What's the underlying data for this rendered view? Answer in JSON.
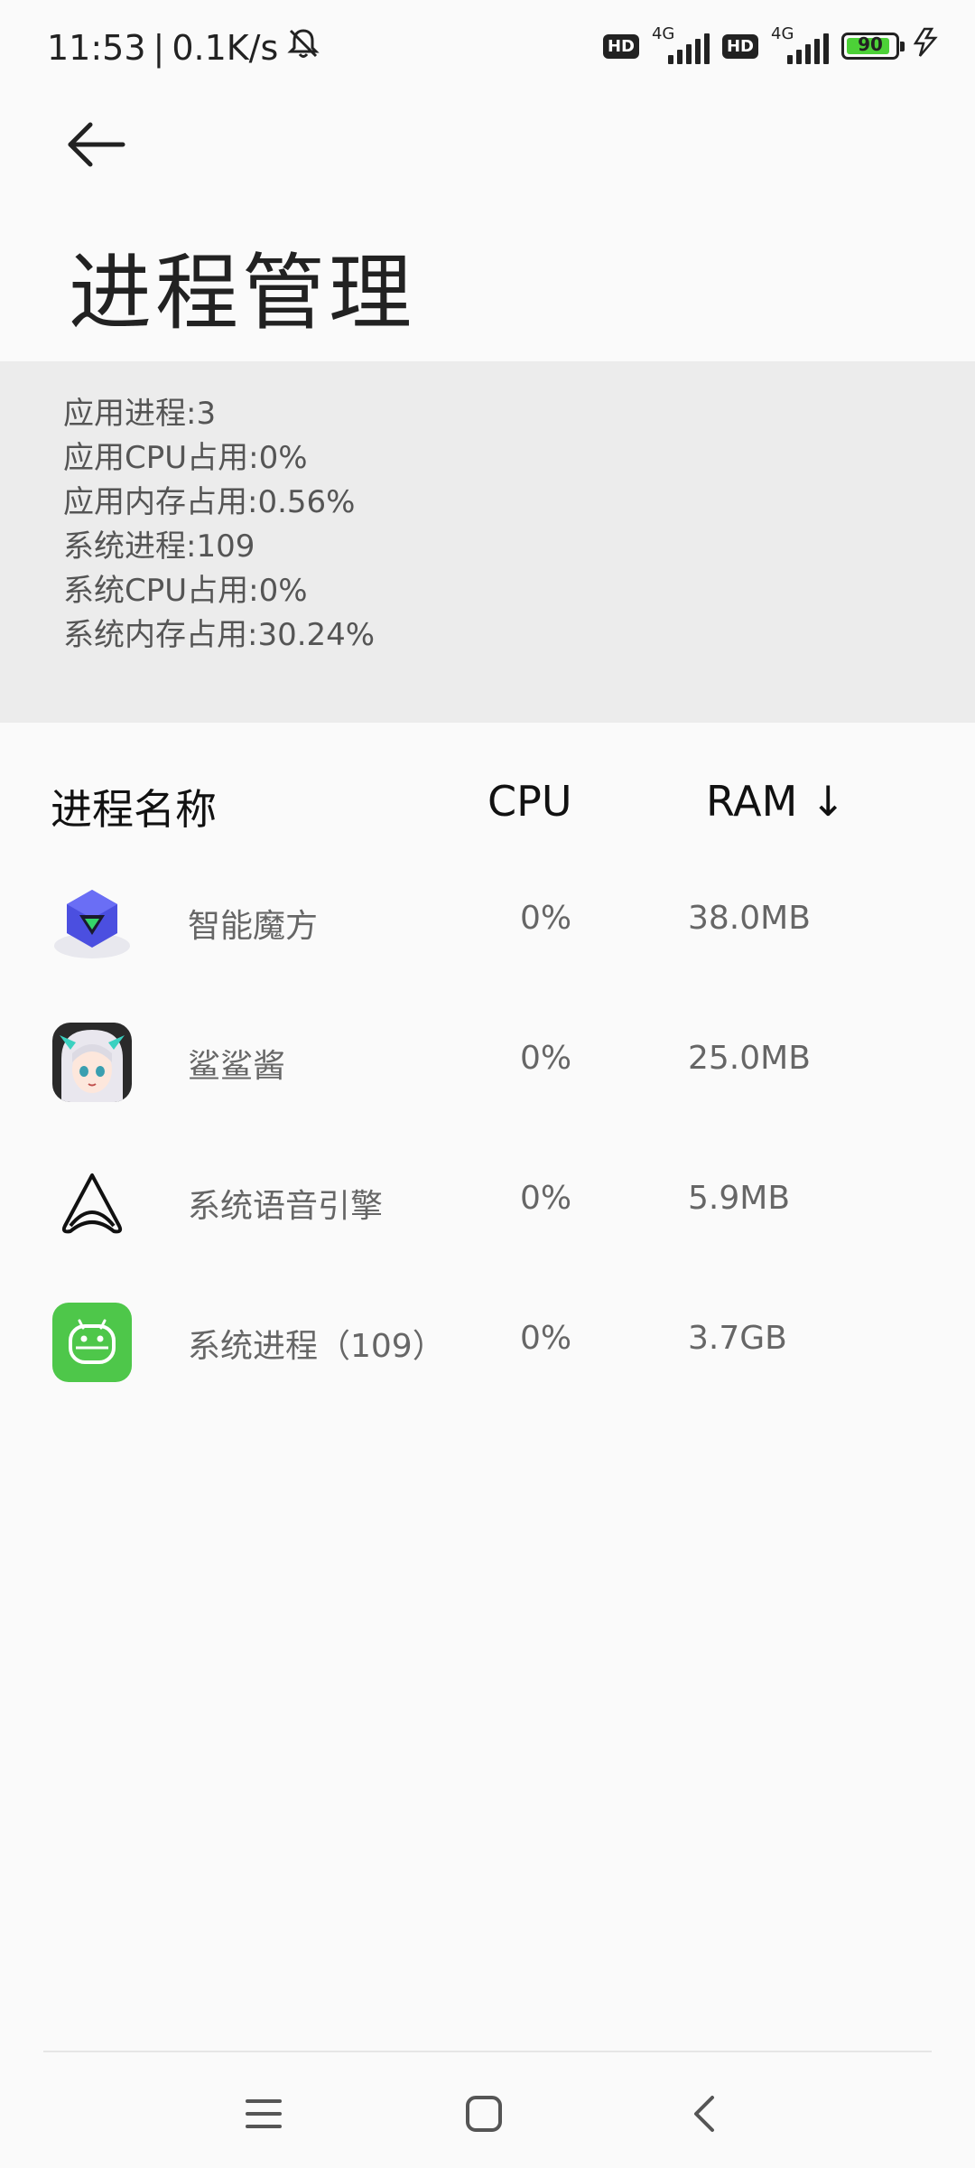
{
  "status_bar": {
    "time": "11:53",
    "separator": "|",
    "net_speed": "0.1K/s",
    "signal1": {
      "hd": "HD",
      "label": "4G"
    },
    "signal2": {
      "hd": "HD",
      "label": "4G"
    },
    "battery": "90",
    "battery_level": 0.9
  },
  "header": {
    "title": "进程管理"
  },
  "summary": {
    "app_processes": "应用进程:3",
    "app_cpu": "应用CPU占用:0%",
    "app_memory": "应用内存占用:0.56%",
    "sys_processes": "系统进程:109",
    "sys_cpu": "系统CPU占用:0%",
    "sys_memory": "系统内存占用:30.24%"
  },
  "list": {
    "columns": {
      "name": "进程名称",
      "cpu": "CPU",
      "ram": "RAM ↓"
    },
    "rows": [
      {
        "name": "智能魔方",
        "cpu": "0%",
        "ram": "38.0MB",
        "icon": "cube-icon"
      },
      {
        "name": "鲨鲨酱",
        "cpu": "0%",
        "ram": "25.0MB",
        "icon": "anime-avatar-icon"
      },
      {
        "name": "系统语音引擎",
        "cpu": "0%",
        "ram": "5.9MB",
        "icon": "voice-engine-icon"
      },
      {
        "name": "系统进程（109）",
        "cpu": "0%",
        "ram": "3.7GB",
        "icon": "android-icon"
      }
    ]
  },
  "colors": {
    "summary_bg": "#ececec",
    "android_green": "#4ec74a",
    "cube_blue": "#4b4fe0",
    "battery_green": "#4cd137"
  }
}
